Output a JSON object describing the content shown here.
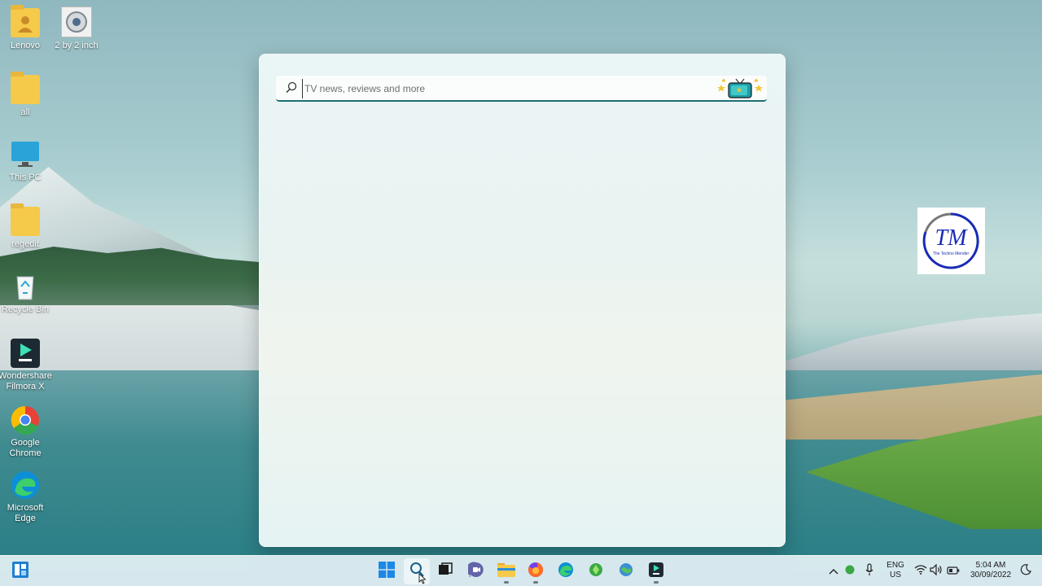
{
  "desktop": {
    "icons": [
      {
        "label": "Lenovo",
        "icon": "user-folder-icon"
      },
      {
        "label": "2 by 2 inch",
        "icon": "photo-file-icon"
      },
      {
        "label": "all",
        "icon": "folder-icon"
      },
      {
        "label": "This PC",
        "icon": "monitor-icon"
      },
      {
        "label": "regedit",
        "icon": "folder-icon"
      },
      {
        "label": "Recycle Bin",
        "icon": "recycle-bin-icon"
      },
      {
        "label": "Wondershare Filmora X",
        "icon": "filmora-icon"
      },
      {
        "label": "Google Chrome",
        "icon": "chrome-icon"
      },
      {
        "label": "Microsoft Edge",
        "icon": "edge-icon"
      }
    ]
  },
  "search_panel": {
    "placeholder": "TV news, reviews and more",
    "highlight_icon": "tv-stars-icon"
  },
  "watermark": {
    "initials": "TM",
    "caption": "The Techno Mender"
  },
  "taskbar": {
    "widgets_icon": "widgets-icon",
    "apps": [
      {
        "name": "start",
        "icon": "windows-start-icon"
      },
      {
        "name": "search",
        "icon": "search-icon",
        "active": true
      },
      {
        "name": "task-view",
        "icon": "task-view-icon"
      },
      {
        "name": "teams-chat",
        "icon": "teams-chat-icon"
      },
      {
        "name": "file-explorer",
        "icon": "file-explorer-icon"
      },
      {
        "name": "firefox",
        "icon": "firefox-icon"
      },
      {
        "name": "edge",
        "icon": "edge-icon"
      },
      {
        "name": "green-app",
        "icon": "green-app-icon"
      },
      {
        "name": "globe-app",
        "icon": "globe-app-icon"
      },
      {
        "name": "filmora",
        "icon": "filmora-icon"
      }
    ],
    "tray": {
      "lang_top": "ENG",
      "lang_bottom": "US",
      "time": "5:04 AM",
      "date": "30/09/2022"
    }
  }
}
